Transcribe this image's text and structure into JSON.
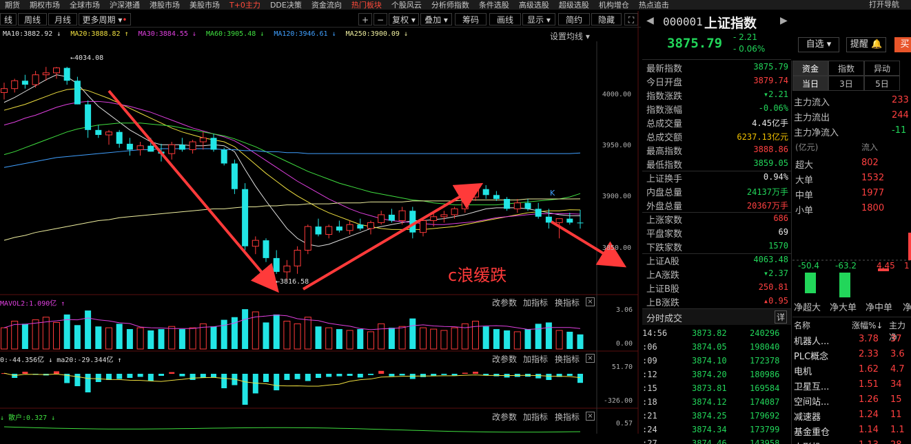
{
  "topmenu": [
    "期货",
    "期权市场",
    "全球市场",
    "沪深港通",
    "港股市场",
    "美股市场",
    "T+0主力",
    "DDE决策",
    "资金流向",
    "热门板块",
    "个股风云",
    "分析师指数",
    "条件选股",
    "高级选股",
    "超级选股",
    "机构增仓",
    "热点追击",
    "打开导航"
  ],
  "toolbar": {
    "day_label": "线",
    "week_label": "周线",
    "month_label": "月线",
    "more_label": "更多周期",
    "plus_label": "+",
    "minus_label": "−",
    "adjust_label": "复权",
    "overlay_label": "叠加",
    "chips_label": "筹码",
    "draw_label": "画线",
    "display_label": "显示",
    "simple_label": "简约",
    "hide_label": "隐藏"
  },
  "ma_legend": {
    "ma10": "MA10:3882.92 ↓",
    "ma20": "MA20:3888.82 ↑",
    "ma30": "MA30:3884.55 ↓",
    "ma60": "MA60:3905.48 ↓",
    "ma120": "MA120:3946.61 ↓",
    "ma250": "MA250:3900.09 ↓",
    "settings": "设置均线 ▾"
  },
  "main_axis": {
    "labels": [
      "4000.00",
      "3950.00",
      "3900.00",
      "3850.00"
    ]
  },
  "annotations": {
    "high": "←4034.08",
    "low": "←3816.58",
    "wave_text": "c浪缓跌",
    "k_mark": "K"
  },
  "sub1": {
    "title": "MAVOL2:1.090亿 ↑",
    "labels": [
      "3.06",
      "0.00"
    ]
  },
  "sub2": {
    "title": "0:-44.356亿 ↓  ma20:-29.344亿 ↑",
    "labels": [
      "51.70",
      "-326.00"
    ]
  },
  "sub3": {
    "title": "↓ 散户:0.327 ↓",
    "labels": [
      "0.57"
    ]
  },
  "sub_buttons": {
    "change_params": "改参数",
    "add_indicator": "加指标",
    "swap_indicator": "换指标",
    "close": "×"
  },
  "right_header": {
    "code": "000001",
    "name": "上证指数",
    "price": "3875.79",
    "change": "- 2.21",
    "change_pct": "- 0.06%",
    "self_select": "自选 ▾",
    "alert": "提醒 🔔",
    "buy": "买"
  },
  "quote_rows": [
    {
      "k": "最新指数",
      "v": "3875.79",
      "c": "green"
    },
    {
      "k": "今日开盘",
      "v": "3879.74",
      "c": "red"
    },
    {
      "k": "指数涨跌",
      "v": "▾2.21",
      "c": "green"
    },
    {
      "k": "指数涨幅",
      "v": "-0.06%",
      "c": "green"
    },
    {
      "k": "总成交量",
      "v": "4.45亿手",
      "c": "white"
    },
    {
      "k": "总成交额",
      "v": "6237.13亿元",
      "c": "yellow"
    },
    {
      "k": "最高指数",
      "v": "3888.86",
      "c": "red"
    },
    {
      "k": "最低指数",
      "v": "3859.05",
      "c": "green"
    },
    {
      "k": "上证换手",
      "v": "0.94%",
      "c": "white"
    },
    {
      "k": "内盘总量",
      "v": "24137万手",
      "c": "green"
    },
    {
      "k": "外盘总量",
      "v": "20367万手",
      "c": "red"
    },
    {
      "k": "上涨家数",
      "v": "686",
      "c": "red"
    },
    {
      "k": "平盘家数",
      "v": "69",
      "c": "white"
    },
    {
      "k": "下跌家数",
      "v": "1570",
      "c": "green"
    },
    {
      "k": "上证A股",
      "v": "4063.48",
      "c": "green"
    },
    {
      "k": "上A涨跌",
      "v": "▾2.37",
      "c": "green"
    },
    {
      "k": "上证B股",
      "v": "250.81",
      "c": "red"
    },
    {
      "k": "上B涨跌",
      "v": "▴0.95",
      "c": "red"
    }
  ],
  "ticks_header": {
    "title": "分时成交",
    "detail": "详"
  },
  "ticks": [
    {
      "t": "14:56",
      "p": "3873.82",
      "v": "240296",
      "pc": "green"
    },
    {
      "t": ":06",
      "p": "3874.05",
      "v": "198040",
      "pc": "green"
    },
    {
      "t": ":09",
      "p": "3874.10",
      "v": "172378",
      "pc": "green"
    },
    {
      "t": ":12",
      "p": "3874.20",
      "v": "180986",
      "pc": "green"
    },
    {
      "t": ":15",
      "p": "3873.81",
      "v": "169584",
      "pc": "green"
    },
    {
      "t": ":18",
      "p": "3874.12",
      "v": "174087",
      "pc": "green"
    },
    {
      "t": ":21",
      "p": "3874.25",
      "v": "179692",
      "pc": "green"
    },
    {
      "t": ":24",
      "p": "3874.34",
      "v": "173799",
      "pc": "green"
    },
    {
      "t": ":27",
      "p": "3874.46",
      "v": "143958",
      "pc": "green"
    }
  ],
  "fund_tabs": {
    "top": [
      "资金",
      "指数",
      "异动"
    ],
    "bottom": [
      "当日",
      "3日",
      "5日"
    ]
  },
  "fund_flow": [
    {
      "k": "主力流入",
      "v": "233"
    },
    {
      "k": "主力流出",
      "v": "244"
    },
    {
      "k": "主力净流入",
      "v": "-11"
    }
  ],
  "order_header": {
    "unit": "(亿元)",
    "inflow": "流入"
  },
  "order_rows": [
    {
      "k": "超大",
      "v": "802"
    },
    {
      "k": "大单",
      "v": "1532"
    },
    {
      "k": "中单",
      "v": "1977"
    },
    {
      "k": "小单",
      "v": "1800"
    }
  ],
  "net_bars": {
    "labels": [
      "净超大",
      "净大单",
      "净中单",
      "净"
    ],
    "values": [
      "-50.4",
      "-63.2",
      "4.45",
      "1"
    ]
  },
  "sector_header": {
    "name": "名称",
    "chg": "涨幅%↓",
    "main": "主力净"
  },
  "sectors": [
    {
      "n": "机器人...",
      "c": "3.78",
      "m": "37"
    },
    {
      "n": "PLC概念",
      "c": "2.33",
      "m": "3.6"
    },
    {
      "n": "电机",
      "c": "1.62",
      "m": "4.7"
    },
    {
      "n": "卫星互...",
      "c": "1.51",
      "m": "34"
    },
    {
      "n": "空间站...",
      "c": "1.26",
      "m": "15"
    },
    {
      "n": "减速器",
      "c": "1.24",
      "m": "11"
    },
    {
      "n": "基金重仓",
      "c": "1.14",
      "m": "1.1"
    },
    {
      "n": "人形机...",
      "c": "1.13",
      "m": "28"
    }
  ],
  "chart_data": {
    "type": "candlestick",
    "series": [
      {
        "name": "K",
        "ohlc": [
          [
            4008,
            4018,
            4001,
            4012
          ],
          [
            4012,
            4022,
            4008,
            4020
          ],
          [
            4020,
            4026,
            4012,
            4016
          ],
          [
            4016,
            4030,
            4013,
            4026
          ],
          [
            4026,
            4034,
            4020,
            4028
          ],
          [
            4028,
            4034,
            4022,
            4033
          ],
          [
            4033,
            4034.08,
            4016,
            4020
          ],
          [
            4020,
            4024,
            3996,
            3996
          ],
          [
            3996,
            4000,
            3962,
            3970
          ],
          [
            3970,
            3975,
            3962,
            3965
          ],
          [
            3965,
            3970,
            3955,
            3968
          ],
          [
            3968,
            3970,
            3952,
            3956
          ],
          [
            3956,
            3962,
            3944,
            3950
          ],
          [
            3950,
            3958,
            3944,
            3954
          ],
          [
            3954,
            3962,
            3948,
            3948
          ],
          [
            3948,
            3956,
            3938,
            3946
          ],
          [
            3946,
            3958,
            3940,
            3955
          ],
          [
            3955,
            3962,
            3948,
            3950
          ],
          [
            3950,
            3960,
            3946,
            3958
          ],
          [
            3958,
            3968,
            3950,
            3962
          ],
          [
            3962,
            3966,
            3948,
            3950
          ],
          [
            3950,
            3952,
            3934,
            3936
          ],
          [
            3936,
            3940,
            3905,
            3910
          ],
          [
            3910,
            3916,
            3848,
            3852
          ],
          [
            3852,
            3862,
            3844,
            3858
          ],
          [
            3858,
            3860,
            3836,
            3840
          ],
          [
            3840,
            3848,
            3824,
            3826
          ],
          [
            3826,
            3838,
            3816.58,
            3832
          ],
          [
            3832,
            3852,
            3824,
            3848
          ],
          [
            3848,
            3874,
            3844,
            3872
          ],
          [
            3872,
            3880,
            3862,
            3864
          ],
          [
            3864,
            3874,
            3860,
            3872
          ],
          [
            3872,
            3878,
            3866,
            3868
          ],
          [
            3868,
            3878,
            3864,
            3874
          ],
          [
            3874,
            3880,
            3868,
            3870
          ],
          [
            3870,
            3878,
            3864,
            3876
          ],
          [
            3876,
            3888,
            3874,
            3884
          ],
          [
            3884,
            3890,
            3876,
            3878
          ],
          [
            3878,
            3892,
            3874,
            3888
          ],
          [
            3888,
            3892,
            3860,
            3866
          ],
          [
            3866,
            3880,
            3862,
            3878
          ],
          [
            3878,
            3886,
            3872,
            3882
          ],
          [
            3882,
            3888,
            3876,
            3884
          ],
          [
            3884,
            3892,
            3880,
            3890
          ],
          [
            3890,
            3904,
            3886,
            3902
          ],
          [
            3902,
            3912,
            3898,
            3910
          ],
          [
            3910,
            3914,
            3900,
            3904
          ],
          [
            3904,
            3908,
            3898,
            3900
          ],
          [
            3900,
            3902,
            3888,
            3890
          ],
          [
            3890,
            3900,
            3886,
            3896
          ],
          [
            3896,
            3900,
            3888,
            3890
          ],
          [
            3890,
            3896,
            3880,
            3882
          ],
          [
            3882,
            3890,
            3870,
            3876
          ],
          [
            3876,
            3880,
            3860,
            3880
          ],
          [
            3880,
            3886,
            3874,
            3876
          ],
          [
            3876,
            3888.86,
            3870,
            3875.79
          ]
        ]
      },
      {
        "name": "MA10",
        "values": [
          3998,
          4003,
          4009,
          4015,
          4021,
          4026,
          4024,
          4017,
          4005,
          3994,
          3986,
          3978,
          3970,
          3964,
          3958,
          3955,
          3955,
          3955,
          3954,
          3954,
          3955,
          3954,
          3948,
          3930,
          3913,
          3898,
          3884,
          3870,
          3860,
          3854,
          3852,
          3854,
          3858,
          3862,
          3866,
          3870,
          3872,
          3874,
          3876,
          3878,
          3878,
          3879,
          3880,
          3882,
          3884,
          3887,
          3890,
          3891,
          3891,
          3891,
          3890,
          3888,
          3886,
          3884,
          3883,
          3882.92
        ]
      },
      {
        "name": "MA20",
        "values": [
          3990,
          3993,
          3996,
          4000,
          4004,
          4008,
          4011,
          4012,
          4010,
          4006,
          4002,
          3997,
          3992,
          3987,
          3982,
          3977,
          3972,
          3968,
          3965,
          3962,
          3960,
          3958,
          3953,
          3944,
          3935,
          3926,
          3918,
          3910,
          3903,
          3897,
          3891,
          3886,
          3882,
          3878,
          3874,
          3872,
          3870,
          3869,
          3869,
          3869,
          3869,
          3870,
          3871,
          3872,
          3874,
          3876,
          3878,
          3880,
          3882,
          3884,
          3886,
          3887,
          3888,
          3888,
          3889,
          3888.82
        ]
      },
      {
        "name": "MA30",
        "values": [
          3975,
          3978,
          3982,
          3985,
          3989,
          3993,
          3996,
          3998,
          3999,
          3999,
          3998,
          3996,
          3994,
          3991,
          3988,
          3984,
          3980,
          3976,
          3972,
          3969,
          3966,
          3963,
          3959,
          3953,
          3946,
          3939,
          3932,
          3925,
          3918,
          3912,
          3906,
          3900,
          3895,
          3890,
          3886,
          3883,
          3880,
          3878,
          3877,
          3876,
          3875,
          3874,
          3874,
          3875,
          3876,
          3877,
          3879,
          3881,
          3882,
          3883,
          3884,
          3885,
          3885,
          3885,
          3885,
          3884.55
        ]
      },
      {
        "name": "MA60",
        "values": [
          3945,
          3948,
          3952,
          3956,
          3960,
          3964,
          3968,
          3971,
          3973,
          3975,
          3976,
          3977,
          3977,
          3977,
          3976,
          3975,
          3974,
          3972,
          3970,
          3968,
          3966,
          3964,
          3961,
          3957,
          3953,
          3948,
          3943,
          3938,
          3933,
          3928,
          3924,
          3920,
          3916,
          3913,
          3910,
          3907,
          3905,
          3903,
          3901,
          3899,
          3898,
          3896,
          3895,
          3894,
          3894,
          3894,
          3894,
          3894,
          3895,
          3896,
          3897,
          3898,
          3899,
          3900,
          3902,
          3905.48
        ]
      },
      {
        "name": "MA120",
        "values": [
          3932,
          3934,
          3936,
          3938,
          3940,
          3942,
          3943,
          3944,
          3945,
          3946,
          3947,
          3948,
          3949,
          3950,
          3950,
          3951,
          3951,
          3951,
          3951,
          3951,
          3951,
          3950,
          3950,
          3949,
          3949,
          3948,
          3948,
          3947,
          3947,
          3946,
          3946,
          3946,
          3946,
          3946,
          3946,
          3946,
          3946,
          3946,
          3946,
          3946,
          3946,
          3946,
          3946,
          3946,
          3946,
          3946,
          3946,
          3946,
          3946,
          3946,
          3946,
          3946,
          3946,
          3946,
          3946,
          3946.61
        ]
      },
      {
        "name": "MA250",
        "values": [
          3858,
          3861,
          3863,
          3866,
          3868,
          3870,
          3872,
          3874,
          3876,
          3878,
          3879,
          3881,
          3882,
          3883,
          3884,
          3885,
          3886,
          3887,
          3888,
          3889,
          3890,
          3890,
          3891,
          3892,
          3892,
          3893,
          3893,
          3894,
          3894,
          3895,
          3895,
          3895,
          3896,
          3896,
          3896,
          3897,
          3897,
          3897,
          3897,
          3898,
          3898,
          3898,
          3898,
          3898,
          3899,
          3899,
          3899,
          3899,
          3899,
          3899,
          3900,
          3900,
          3900,
          3900,
          3900,
          3900.09
        ]
      }
    ],
    "ylim": [
      3805,
      4060
    ],
    "volume": [
      1.6,
      2.1,
      1.9,
      2.2,
      2.4,
      2.0,
      2.6,
      1.8,
      2.9,
      1.7,
      1.6,
      1.9,
      1.5,
      1.6,
      1.4,
      1.5,
      1.7,
      1.5,
      1.6,
      1.9,
      1.7,
      2.2,
      2.4,
      3.0,
      2.8,
      2.0,
      2.6,
      2.1,
      1.9,
      2.4,
      1.7,
      1.6,
      1.5,
      1.4,
      1.5,
      1.3,
      1.9,
      1.6,
      1.7,
      2.3,
      1.6,
      1.5,
      1.4,
      1.6,
      1.9,
      2.1,
      1.7,
      1.5,
      1.4,
      1.3,
      1.5,
      1.9,
      2.0,
      1.4,
      1.3,
      1.1
    ],
    "flow": [
      3,
      -20,
      10,
      -5,
      -8,
      12,
      -45,
      -60,
      -90,
      -40,
      -30,
      -25,
      -20,
      -15,
      -35,
      -10,
      8,
      -12,
      -30,
      -20,
      -18,
      -70,
      -55,
      -150,
      -95,
      -40,
      -80,
      -30,
      -26,
      -35,
      -20,
      -15,
      -12,
      -10,
      -18,
      -6,
      14,
      -12,
      -8,
      -25,
      -16,
      -10,
      -6,
      -8,
      5,
      10,
      -8,
      -12,
      -18,
      -15,
      -14,
      -22,
      -30,
      -15,
      -10,
      -44
    ]
  }
}
